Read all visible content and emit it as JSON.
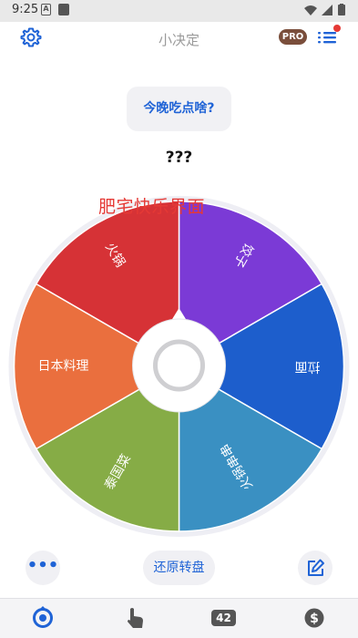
{
  "status_bar": {
    "time": "9:25",
    "a_icon_letter": "A"
  },
  "app_bar": {
    "title": "小决定",
    "pro_label": "PRO"
  },
  "question": "今晚吃点啥?",
  "result": "???",
  "overlay_text": "肥宅快乐界面",
  "wheel": {
    "segments": [
      {
        "label": "饺子",
        "color": "#7b3ad6"
      },
      {
        "label": "拉面",
        "color": "#1d5ecc"
      },
      {
        "label": "火锅串串",
        "color": "#3a90c2"
      },
      {
        "label": "泰国菜",
        "color": "#86ac46"
      },
      {
        "label": "日本料理",
        "color": "#ea6f3e"
      },
      {
        "label": "火锅",
        "color": "#d63236"
      }
    ]
  },
  "actions": {
    "more_label": "•••",
    "reset_label": "还原转盘"
  },
  "tab_bar": {
    "count_label": "42"
  },
  "colors": {
    "accent": "#1f63d6",
    "notification": "#e53935"
  }
}
